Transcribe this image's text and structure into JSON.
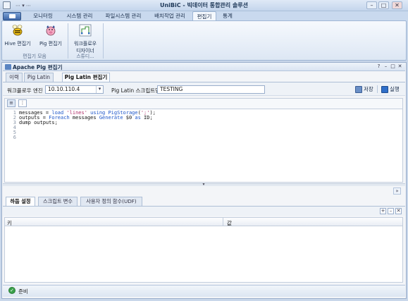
{
  "window": {
    "title": "UniBiC - 빅데이터 통합관리 솔루션",
    "quick_access": "⋯ ▾ ⋯",
    "controls": {
      "minimize": "–",
      "maximize": "□",
      "close": "✕"
    }
  },
  "ribbon": {
    "tabs": [
      "모니터링",
      "시스템 관리",
      "파일시스템 관리",
      "배치작업 관리",
      "편집기",
      "통계"
    ],
    "active_tab": "편집기",
    "buttons": {
      "hive": "Hive 편집기",
      "pig": "Pig 편집기",
      "workflow_line1": "워크플로우",
      "workflow_line2": "디자이너"
    },
    "groups": {
      "editors": "편집기 모음",
      "studio": "스튜디..."
    }
  },
  "document": {
    "title": "Apache Pig 편집기",
    "header_buttons": [
      "?",
      "–",
      "□",
      "✕"
    ],
    "tabs": [
      "이력",
      "Pig Latin",
      "Pig Latin 편집기"
    ],
    "active_tab": "Pig Latin 편집기"
  },
  "toolbar": {
    "engine_label": "워크플로우 엔진",
    "engine_value": "10.10.110.4",
    "script_label": "Pig Latin 스크립트명",
    "script_value": "TESTING",
    "save": "저장",
    "run": "실행"
  },
  "editor": {
    "line_numbers": [
      "1",
      "2",
      "3",
      "4",
      "5",
      "6"
    ],
    "lines": [
      [
        {
          "t": "messages = "
        },
        {
          "t": "load",
          "k": "kw"
        },
        {
          "t": " "
        },
        {
          "t": "'lines'",
          "k": "str"
        },
        {
          "t": " "
        },
        {
          "t": "using",
          "k": "kw"
        },
        {
          "t": " "
        },
        {
          "t": "PigStorage",
          "k": "kw"
        },
        {
          "t": "("
        },
        {
          "t": "';'",
          "k": "str"
        },
        {
          "t": ");"
        }
      ],
      [
        {
          "t": "outputs = "
        },
        {
          "t": "Foreach",
          "k": "kw"
        },
        {
          "t": " messages "
        },
        {
          "t": "Generate",
          "k": "kw"
        },
        {
          "t": " $0 "
        },
        {
          "t": "as",
          "k": "kw"
        },
        {
          "t": " ID;"
        }
      ],
      [
        {
          "t": "dump outputs;"
        }
      ],
      [
        {
          "t": ""
        }
      ],
      [
        {
          "t": ""
        }
      ],
      [
        {
          "t": ""
        }
      ]
    ]
  },
  "bottom_panel": {
    "tabs": [
      "하둡 설정",
      "스크립트 변수",
      "사용자 정의 함수(UDF)"
    ],
    "active_tab": "하둡 설정",
    "grid_buttons": [
      "+",
      "–",
      "✕"
    ],
    "columns": [
      "키",
      "값"
    ],
    "collapse": "»"
  },
  "status": {
    "text": "준비",
    "color": "#3aa14a"
  },
  "colors": {
    "accent": "#5a84c1",
    "frame": "#c9d7ea"
  }
}
